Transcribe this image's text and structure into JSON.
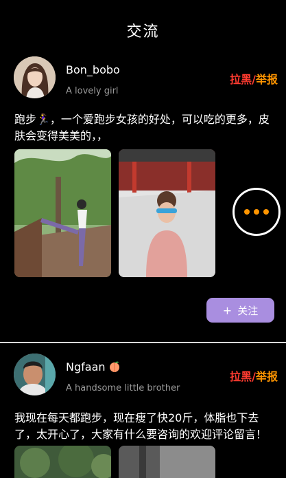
{
  "header": {
    "title": "交流"
  },
  "posts": [
    {
      "username": "Bon_bobo",
      "subtitle": "A lovely girl",
      "actions": {
        "block": "拉黑",
        "separator": "/",
        "report": "举报"
      },
      "text": "跑步🏃‍♀️，一个爱跑步女孩的好处，可以吃的更多，皮肤会变得美美的，，",
      "follow_label": "关注",
      "follow_icon": "plus-icon",
      "more_icon": "more-dots-icon"
    },
    {
      "username": "Ngfaan",
      "username_emoji": "peach-icon",
      "subtitle": "A handsome little brother",
      "actions": {
        "block": "拉黑",
        "separator": "/",
        "report": "举报"
      },
      "text": "我现在每天都跑步，现在瘦了快20斤，体脂也下去了，太开心了，大家有什么要咨询的欢迎评论留言！"
    }
  ],
  "colors": {
    "background": "#000000",
    "block": "#ff3b30",
    "report": "#ff9500",
    "follow_button": "#a98ee0",
    "subtitle": "#9a9a9a"
  }
}
